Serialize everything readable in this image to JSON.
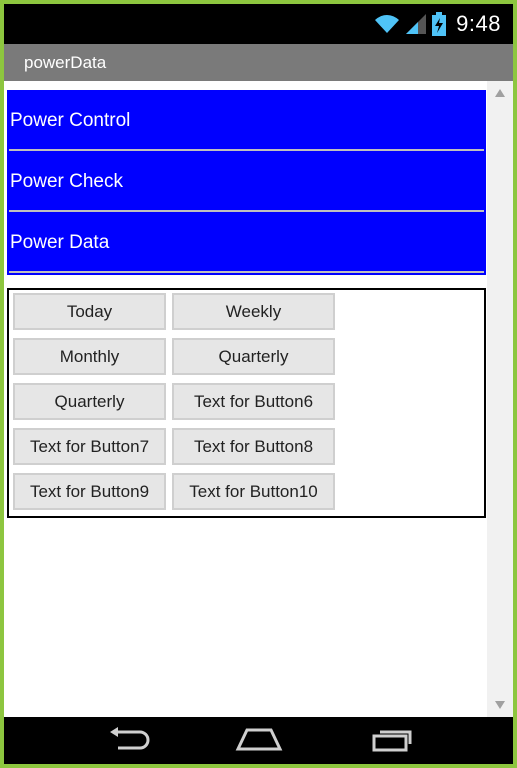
{
  "status_bar": {
    "time": "9:48",
    "icons": [
      "wifi-icon",
      "signal-icon",
      "battery-charging-icon"
    ]
  },
  "app_bar": {
    "title": "powerData"
  },
  "menu": {
    "items": [
      {
        "label": "Power Control"
      },
      {
        "label": "Power Check"
      },
      {
        "label": "Power Data"
      }
    ],
    "background_color": "#0000ff"
  },
  "buttons": {
    "today": "Today",
    "weekly": "Weekly",
    "monthly": "Monthly",
    "quarterly_1": "Quarterly",
    "quarterly_2": "Quarterly",
    "button6": "Text for Button6",
    "button7": "Text for Button7",
    "button8": "Text for Button8",
    "button9": "Text for Button9",
    "button10": "Text for Button10"
  },
  "nav_bar": {
    "icons": [
      "back-icon",
      "home-icon",
      "recents-icon"
    ]
  },
  "colors": {
    "frame": "#8dc63f",
    "app_bar": "#7a7a7a",
    "menu": "#0000ff"
  }
}
